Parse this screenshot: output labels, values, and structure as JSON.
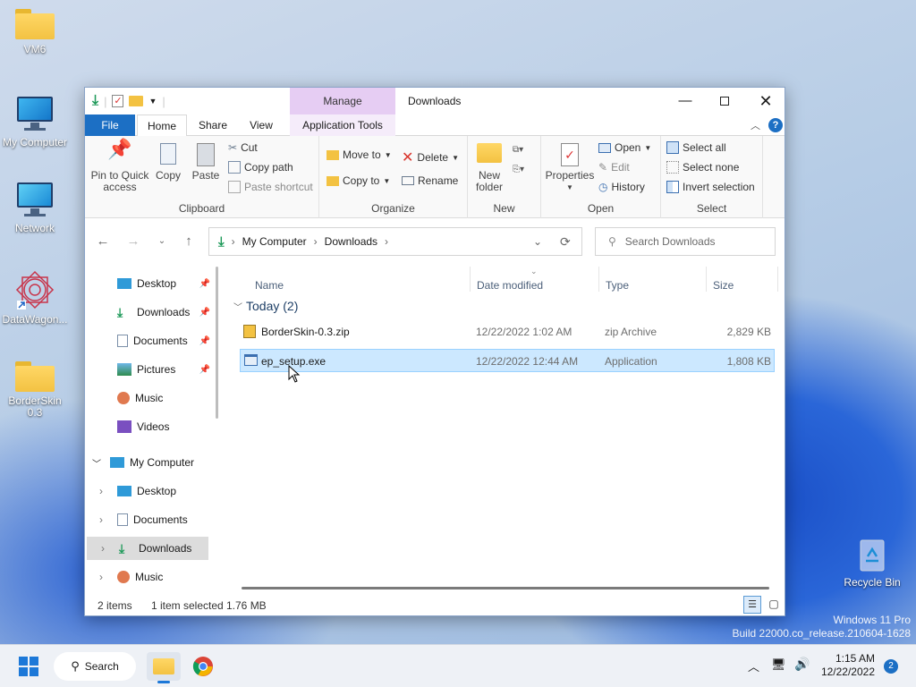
{
  "desktop": {
    "icons": [
      {
        "label": "VM6",
        "icon": "folder-icon"
      },
      {
        "label": "My Computer",
        "icon": "monitor-icon"
      },
      {
        "label": "Network",
        "icon": "network-icon"
      },
      {
        "label": "DataWagon...",
        "icon": "datawagon-icon"
      },
      {
        "label": "BorderSkin\n0.3",
        "icon": "folder-icon"
      },
      {
        "label": "Recycle Bin",
        "icon": "recycle-bin-icon"
      }
    ],
    "watermark": {
      "line1": "Windows 11 Pro",
      "line2": "Build 22000.co_release.210604-1628"
    }
  },
  "window": {
    "title": "Downloads",
    "manage_tab": "Manage",
    "tabs": {
      "file": "File",
      "home": "Home",
      "share": "Share",
      "view": "View",
      "app_tools": "Application Tools"
    },
    "ribbon": {
      "clipboard": {
        "label": "Clipboard",
        "pin": "Pin to Quick\naccess",
        "copy": "Copy",
        "paste": "Paste",
        "cut": "Cut",
        "copy_path": "Copy path",
        "paste_shortcut": "Paste shortcut"
      },
      "organize": {
        "label": "Organize",
        "move_to": "Move to",
        "copy_to": "Copy to",
        "delete": "Delete",
        "rename": "Rename"
      },
      "new": {
        "label": "New",
        "new_folder": "New\nfolder"
      },
      "open": {
        "label": "Open",
        "properties": "Properties",
        "open": "Open",
        "edit": "Edit",
        "history": "History"
      },
      "select": {
        "label": "Select",
        "select_all": "Select all",
        "select_none": "Select none",
        "invert": "Invert selection"
      }
    },
    "address": {
      "root": "My Computer",
      "current": "Downloads"
    },
    "search": {
      "placeholder": "Search Downloads"
    },
    "nav": {
      "quick": [
        {
          "label": "Desktop",
          "pinned": true
        },
        {
          "label": "Downloads",
          "pinned": true
        },
        {
          "label": "Documents",
          "pinned": true
        },
        {
          "label": "Pictures",
          "pinned": true
        },
        {
          "label": "Music",
          "pinned": false
        },
        {
          "label": "Videos",
          "pinned": false
        }
      ],
      "my_computer": "My Computer",
      "children": [
        "Desktop",
        "Documents",
        "Downloads",
        "Music"
      ]
    },
    "columns": {
      "name": "Name",
      "date": "Date modified",
      "type": "Type",
      "size": "Size"
    },
    "group": "Today (2)",
    "files": [
      {
        "name": "BorderSkin-0.3.zip",
        "date": "12/22/2022 1:02 AM",
        "type": "zip Archive",
        "size": "2,829 KB"
      },
      {
        "name": "ep_setup.exe",
        "date": "12/22/2022 12:44 AM",
        "type": "Application",
        "size": "1,808 KB"
      }
    ],
    "status": {
      "items": "2 items",
      "selected": "1 item selected",
      "size": "1.76 MB"
    }
  },
  "taskbar": {
    "search_label": "Search",
    "time": "1:15 AM",
    "date": "12/22/2022",
    "notif_count": "2"
  }
}
